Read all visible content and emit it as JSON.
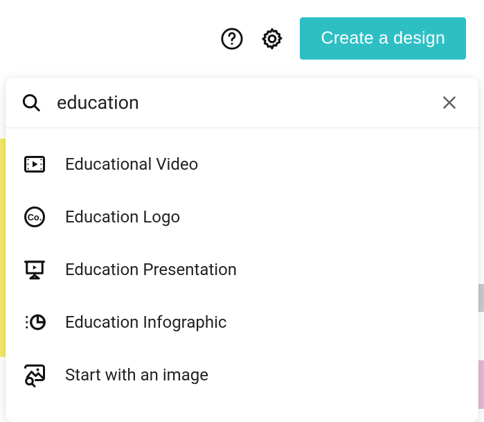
{
  "header": {
    "create_label": "Create a design"
  },
  "search": {
    "value": "education",
    "placeholder": "Search"
  },
  "suggestions": [
    {
      "icon": "video",
      "label": "Educational Video"
    },
    {
      "icon": "logo",
      "label": "Education Logo"
    },
    {
      "icon": "presentation",
      "label": "Education Presentation"
    },
    {
      "icon": "infographic",
      "label": "Education Infographic"
    },
    {
      "icon": "image",
      "label": "Start with an image"
    }
  ],
  "colors": {
    "accent": "#2ebfc4"
  }
}
